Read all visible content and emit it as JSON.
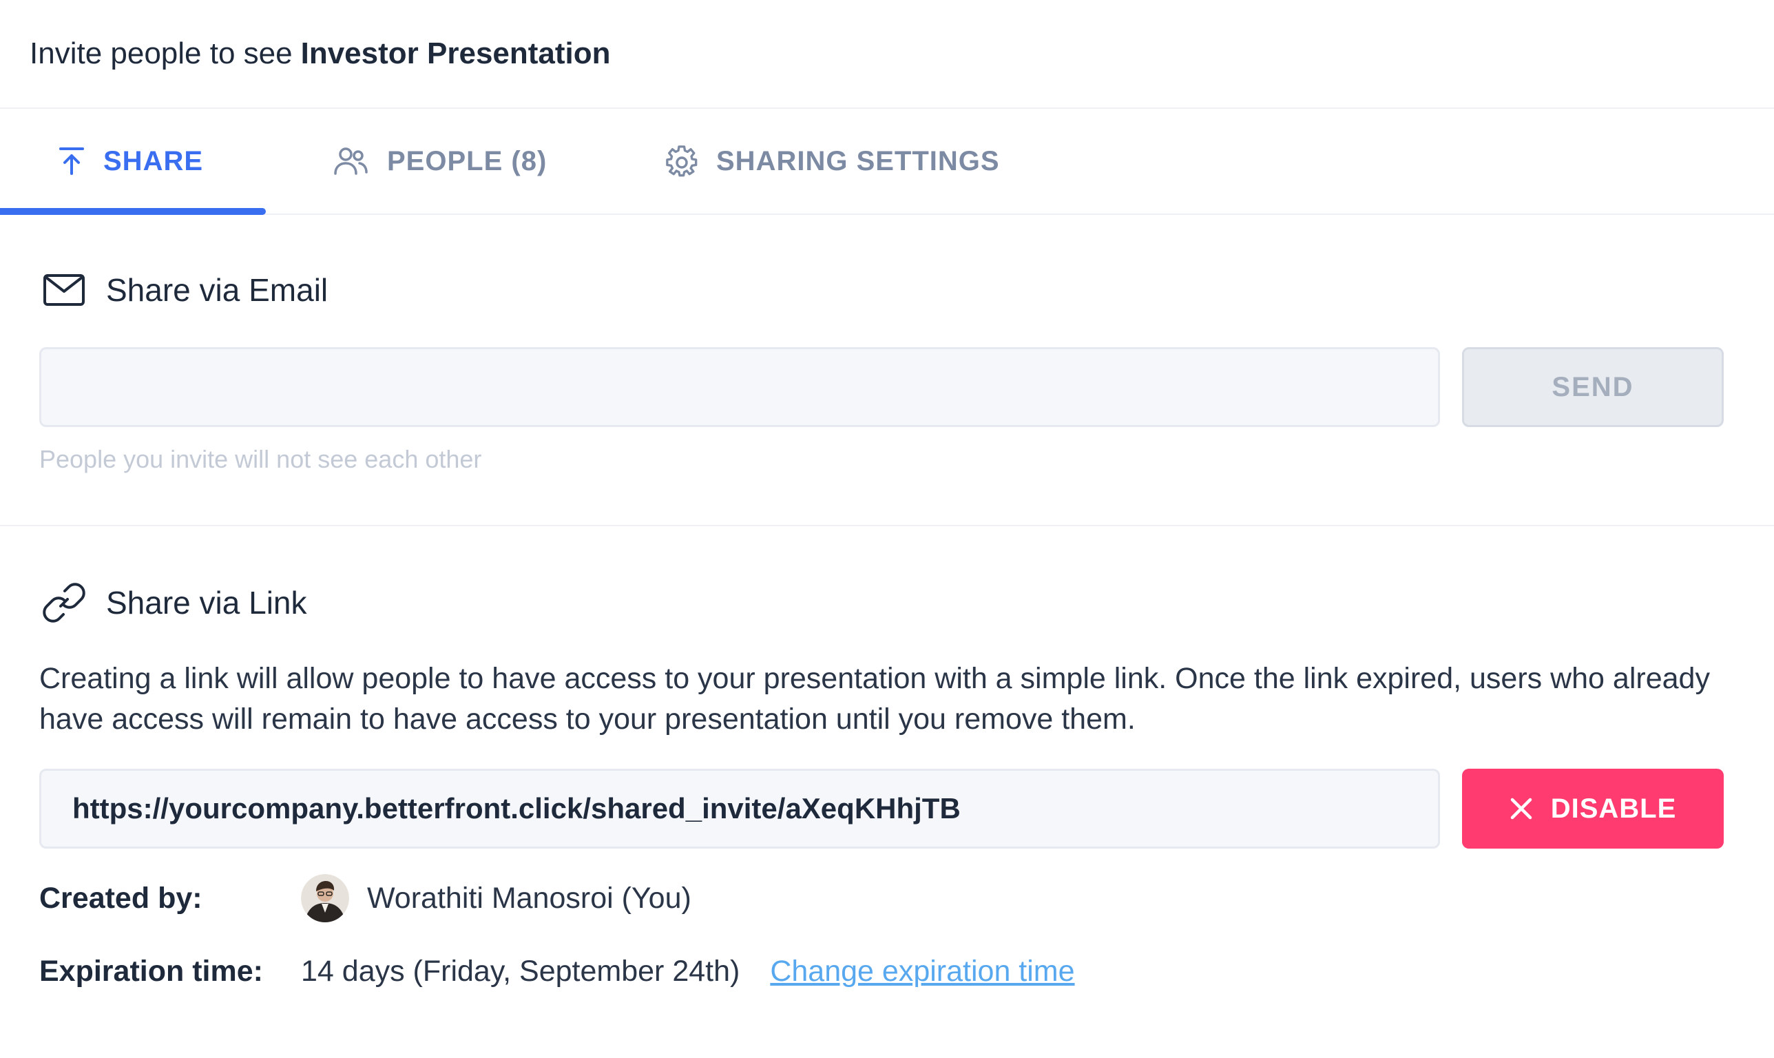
{
  "header": {
    "title_prefix": "Invite people to see ",
    "title_name": "Investor Presentation"
  },
  "tabs": [
    {
      "label": "SHARE",
      "icon": "upload-icon",
      "active": true
    },
    {
      "label": "PEOPLE (8)",
      "icon": "people-icon",
      "active": false
    },
    {
      "label": "SHARING SETTINGS",
      "icon": "gear-icon",
      "active": false
    }
  ],
  "email_section": {
    "title": "Share via Email",
    "icon": "envelope-icon",
    "input_value": "",
    "send_label": "SEND",
    "hint": "People you invite will not see each other"
  },
  "link_section": {
    "title": "Share via Link",
    "icon": "link-icon",
    "description": "Creating a link will allow people to have access to your presentation with a simple link. Once the link expired, users who already have access will remain to have access to your presentation until you remove them.",
    "url": "https://yourcompany.betterfront.click/shared_invite/aXeqKHhjTB",
    "disable_label": "DISABLE",
    "created_by_label": "Created by:",
    "created_by_value": "Worathiti Manosroi (You)",
    "expiration_label": "Expiration time:",
    "expiration_value": "14 days (Friday, September 24th)",
    "change_expiration_label": "Change expiration time"
  },
  "colors": {
    "accent": "#3a6ef0",
    "danger": "#ff3b6f",
    "link": "#58a8f0",
    "muted": "#7d8aa3"
  }
}
